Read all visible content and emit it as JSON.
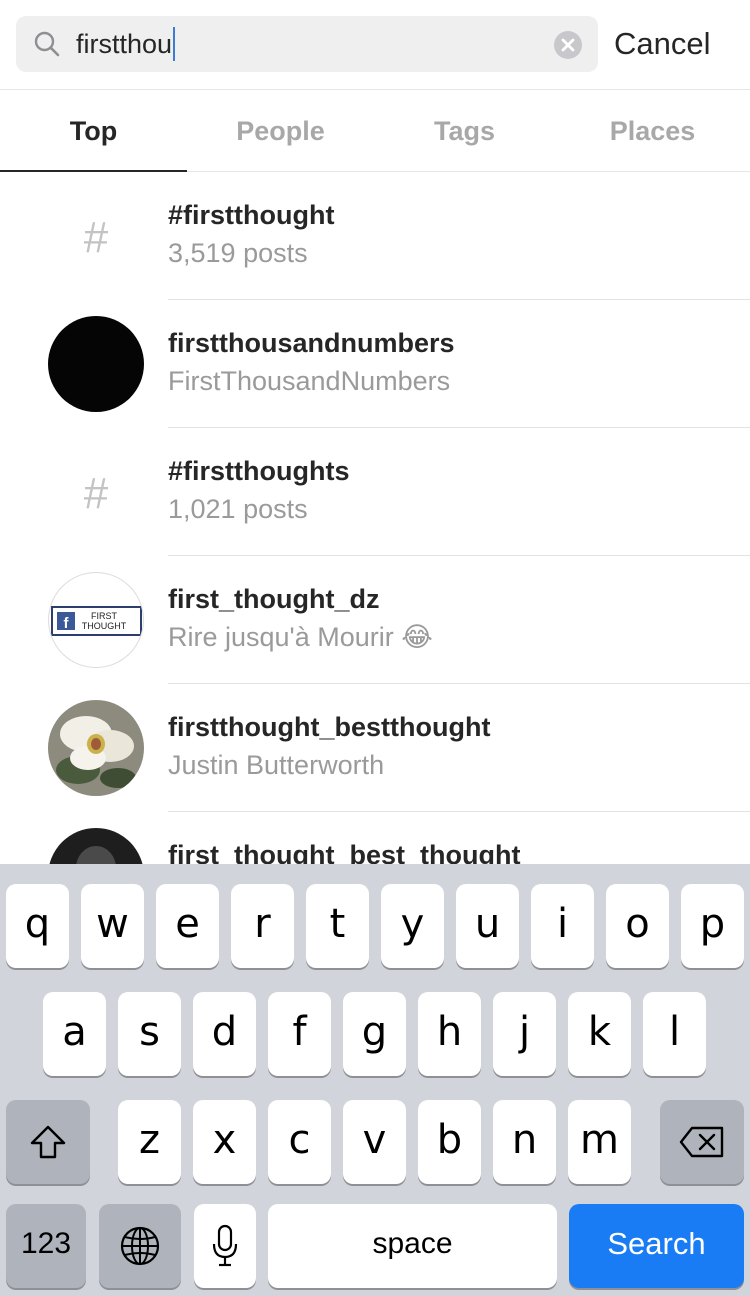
{
  "search": {
    "query": "firstthou",
    "cancel_label": "Cancel"
  },
  "tabs": [
    {
      "label": "Top",
      "active": true
    },
    {
      "label": "People",
      "active": false
    },
    {
      "label": "Tags",
      "active": false
    },
    {
      "label": "Places",
      "active": false
    }
  ],
  "results": [
    {
      "type": "hashtag",
      "title": "#firstthought",
      "subtitle": "3,519 posts",
      "icon": "hashtag-icon"
    },
    {
      "type": "user",
      "title": "firstthousandnumbers",
      "subtitle": "FirstThousandNumbers",
      "avatar": "black-circle"
    },
    {
      "type": "hashtag",
      "title": "#firstthoughts",
      "subtitle": "1,021 posts",
      "icon": "hashtag-icon"
    },
    {
      "type": "user",
      "title": "first_thought_dz",
      "subtitle": "Rire jusqu'à Mourir 😂",
      "avatar": "first-thought-logo",
      "logo_text_1": "FIRST",
      "logo_text_2": "THOUGHT"
    },
    {
      "type": "user",
      "title": "firstthought_bestthought",
      "subtitle": "Justin Butterworth",
      "avatar": "magnolia-photo"
    },
    {
      "type": "user",
      "title": "first_thought_best_thought",
      "subtitle": "",
      "avatar": "dark-photo"
    }
  ],
  "hash_symbol": "#",
  "keyboard": {
    "row1": [
      "q",
      "w",
      "e",
      "r",
      "t",
      "y",
      "u",
      "i",
      "o",
      "p"
    ],
    "row2": [
      "a",
      "s",
      "d",
      "f",
      "g",
      "h",
      "j",
      "k",
      "l"
    ],
    "row3": [
      "z",
      "x",
      "c",
      "v",
      "b",
      "n",
      "m"
    ],
    "numbers_label": "123",
    "space_label": "space",
    "search_label": "Search"
  },
  "colors": {
    "accent": "#1a7cf5",
    "text": "#262626",
    "muted": "#9a9a9a"
  }
}
